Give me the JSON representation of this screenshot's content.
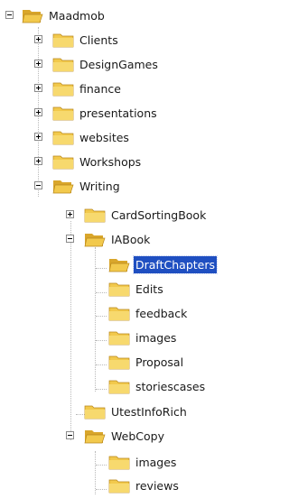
{
  "colors": {
    "folder": "#f2c94c",
    "folder_dark": "#d9a62b",
    "selection": "#1f4fc1"
  },
  "tree": {
    "root": {
      "label": "Maadmob",
      "icon": "folder-icon",
      "state": "expanded"
    },
    "level1": [
      {
        "label": "Clients",
        "state": "collapsed"
      },
      {
        "label": "DesignGames",
        "state": "collapsed"
      },
      {
        "label": "finance",
        "state": "collapsed"
      },
      {
        "label": "presentations",
        "state": "collapsed"
      },
      {
        "label": "websites",
        "state": "collapsed"
      },
      {
        "label": "Workshops",
        "state": "collapsed"
      },
      {
        "label": "Writing",
        "state": "expanded"
      }
    ],
    "writing_children": [
      {
        "label": "CardSortingBook",
        "state": "collapsed"
      },
      {
        "label": "IABook",
        "state": "expanded"
      }
    ],
    "iabook_children": [
      {
        "label": "DraftChapters",
        "selected": true
      },
      {
        "label": "Edits"
      },
      {
        "label": "feedback"
      },
      {
        "label": "images"
      },
      {
        "label": "Proposal"
      },
      {
        "label": "storiescases"
      }
    ],
    "writing_more": [
      {
        "label": "UtestInfoRich"
      },
      {
        "label": "WebCopy",
        "state": "expanded"
      }
    ],
    "webcopy_children": [
      {
        "label": "images"
      },
      {
        "label": "reviews"
      }
    ]
  }
}
